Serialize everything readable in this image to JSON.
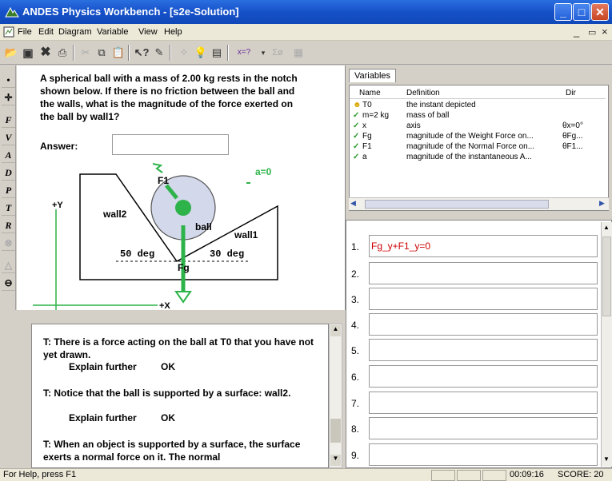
{
  "window": {
    "title": "ANDES Physics Workbench - [s2e-Solution]"
  },
  "menu": [
    "File",
    "Edit",
    "Diagram",
    "Variable",
    "View",
    "Help"
  ],
  "toolbar": {
    "answer_dropdown": "x=?",
    "sigma_btn": "Σø"
  },
  "tools": [
    "•",
    "✛",
    "F",
    "V",
    "A",
    "D",
    "P",
    "T",
    "R"
  ],
  "problem": {
    "text": "A spherical ball with a mass of 2.00 kg rests in the notch shown below.  If there is no friction between the ball and the walls, what is the magnitude of the force exerted on the ball by wall1?",
    "answer_label": "Answer:",
    "answer_value": ""
  },
  "diagram": {
    "f1": "F1",
    "a0": "a=0",
    "y": "+Y",
    "x": "+X",
    "wall2": "wall2",
    "ball": "ball",
    "wall1": "wall1",
    "deg50": "50 deg",
    "deg30": "30 deg",
    "fg": "Fg"
  },
  "tutor": {
    "m1": "T: There is a force acting on the ball at T0 that you have not yet drawn.",
    "m2": "T: Notice that the ball is supported by a surface: wall2.",
    "m3": "T: When an object is supported by a surface, the surface exerts a normal force on it.  The normal",
    "explain": "Explain further",
    "ok": "OK"
  },
  "variables": {
    "tab": "Variables",
    "headers": [
      "Name",
      "Definition",
      "Dir"
    ],
    "rows": [
      {
        "name": "T0",
        "def": "the instant depicted",
        "dir": "",
        "icon": "smiley-icon"
      },
      {
        "name": "m=2 kg",
        "def": "mass of ball",
        "dir": "",
        "icon": "check-icon"
      },
      {
        "name": "x",
        "def": "axis",
        "dir": "θx=0°",
        "icon": "check-icon"
      },
      {
        "name": "Fg",
        "def": "magnitude of the Weight Force on...",
        "dir": "θFg...",
        "icon": "check-icon"
      },
      {
        "name": "F1",
        "def": "magnitude of the Normal Force on...",
        "dir": "θF1...",
        "icon": "check-icon"
      },
      {
        "name": "a",
        "def": "magnitude of the instantaneous A...",
        "dir": "",
        "icon": "check-icon"
      }
    ]
  },
  "equations": {
    "numbers": [
      "1.",
      "2.",
      "3.",
      "4.",
      "5.",
      "6.",
      "7.",
      "8.",
      "9."
    ],
    "values": [
      "Fg_y+F1_y=0",
      "",
      "",
      "",
      "",
      "",
      "",
      "",
      ""
    ]
  },
  "status": {
    "help": "For Help, press F1",
    "time": "00:09:16",
    "score": "SCORE: 20"
  }
}
